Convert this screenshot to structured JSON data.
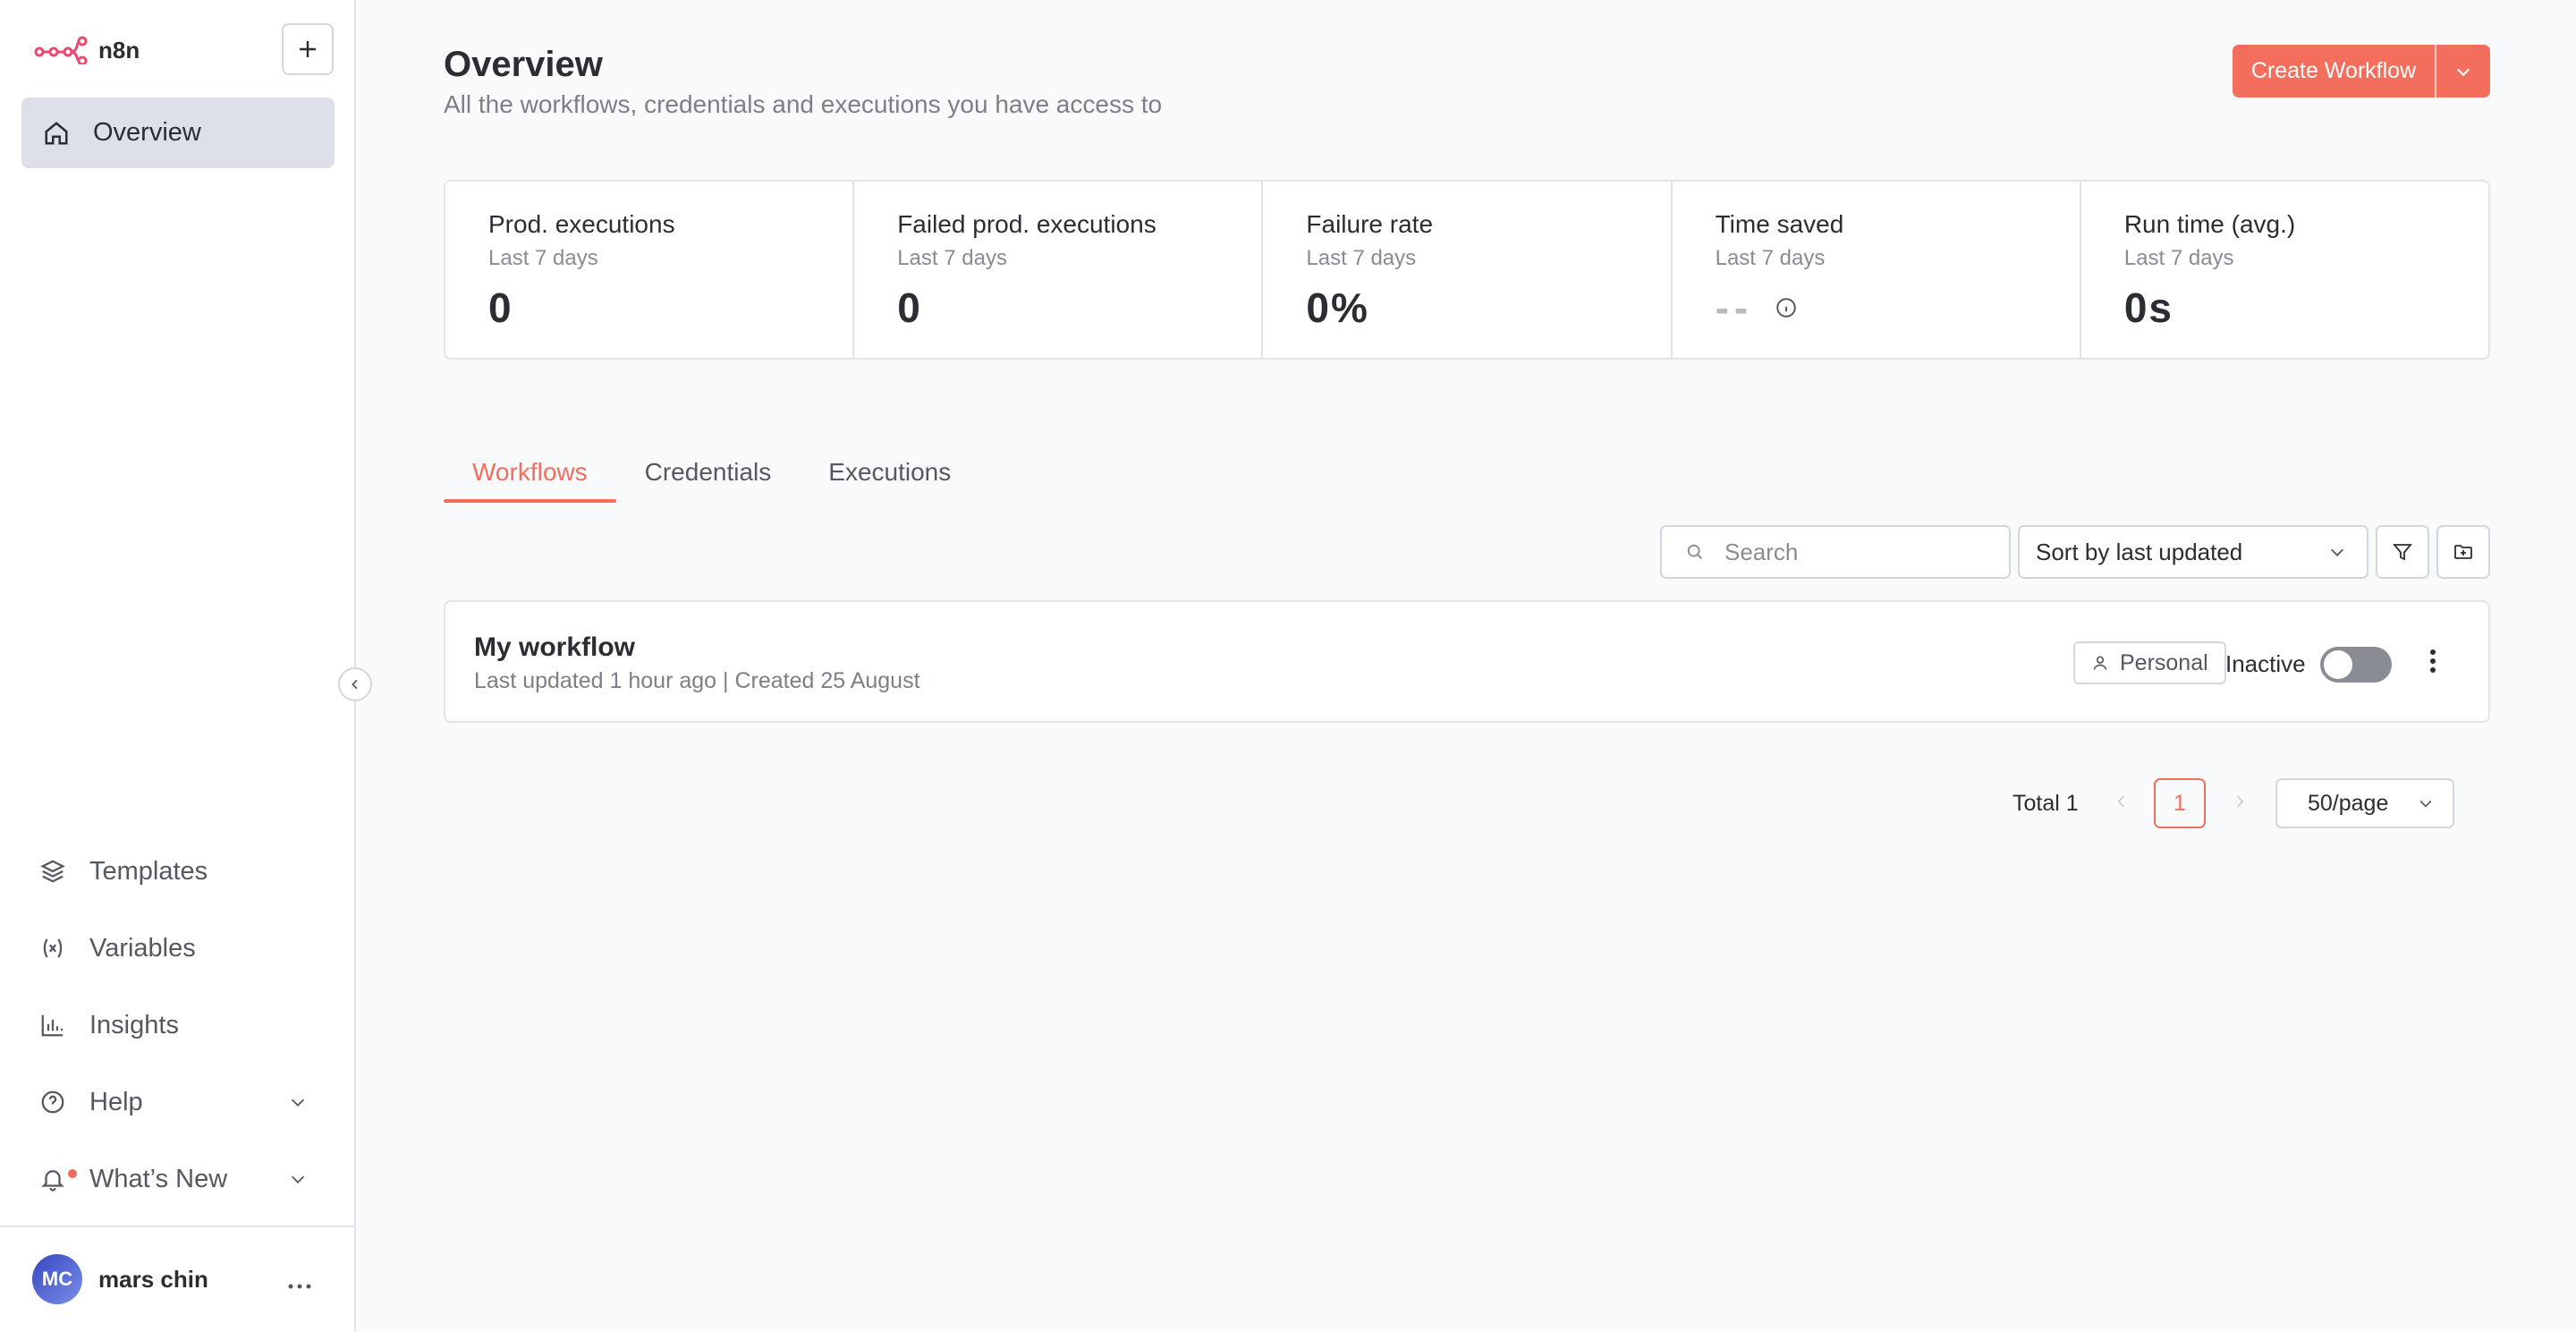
{
  "app": {
    "name": "n8n"
  },
  "sidebar": {
    "overview_label": "Overview",
    "bottom_items": [
      {
        "label": "Templates",
        "icon": "templates-icon"
      },
      {
        "label": "Variables",
        "icon": "variables-icon"
      },
      {
        "label": "Insights",
        "icon": "insights-icon"
      },
      {
        "label": "Help",
        "icon": "help-icon"
      },
      {
        "label": "What’s New",
        "icon": "bell-icon"
      }
    ],
    "user": {
      "initials": "MC",
      "name": "mars chin"
    }
  },
  "header": {
    "title": "Overview",
    "subtitle": "All the workflows, credentials and executions you have access to",
    "create_label": "Create Workflow"
  },
  "stats": [
    {
      "title": "Prod. executions",
      "period": "Last 7 days",
      "value": "0"
    },
    {
      "title": "Failed prod. executions",
      "period": "Last 7 days",
      "value": "0"
    },
    {
      "title": "Failure rate",
      "period": "Last 7 days",
      "value": "0%"
    },
    {
      "title": "Time saved",
      "period": "Last 7 days",
      "value": "--"
    },
    {
      "title": "Run time (avg.)",
      "period": "Last 7 days",
      "value": "0s"
    }
  ],
  "tabs": [
    "Workflows",
    "Credentials",
    "Executions"
  ],
  "toolbar": {
    "search_placeholder": "Search",
    "sort_label": "Sort by last updated"
  },
  "workflow": {
    "name": "My workflow",
    "meta": "Last updated 1 hour ago | Created 25 August",
    "owner_badge": "Personal",
    "status": "Inactive"
  },
  "pagination": {
    "total": "Total 1",
    "current_page": "1",
    "page_size": "50/page"
  },
  "colors": {
    "accent": "#f36e5c",
    "logo": "#ea4b71"
  }
}
